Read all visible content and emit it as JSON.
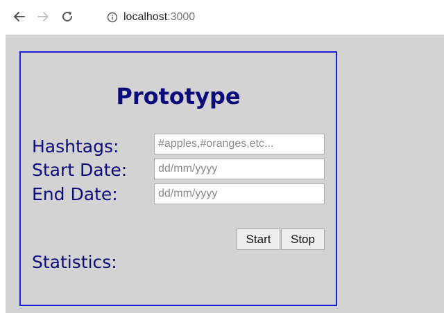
{
  "browser": {
    "url_host": "localhost",
    "url_port": ":3000"
  },
  "page": {
    "title": "Prototype",
    "hashtags_label": "Hashtags:",
    "hashtags_placeholder": "#apples,#oranges,etc...",
    "start_date_label": "Start Date:",
    "start_date_placeholder": "dd/mm/yyyy",
    "end_date_label": "End Date:",
    "end_date_placeholder": "dd/mm/yyyy",
    "start_button": "Start",
    "stop_button": "Stop",
    "statistics_label": "Statistics:"
  },
  "colors": {
    "page_background": "#d3d3d3",
    "panel_border": "#1a1ad6",
    "text": "#0b0b7a"
  },
  "icons": {
    "back": "arrow-left-icon",
    "forward": "arrow-right-icon",
    "reload": "reload-icon",
    "info": "info-icon"
  }
}
